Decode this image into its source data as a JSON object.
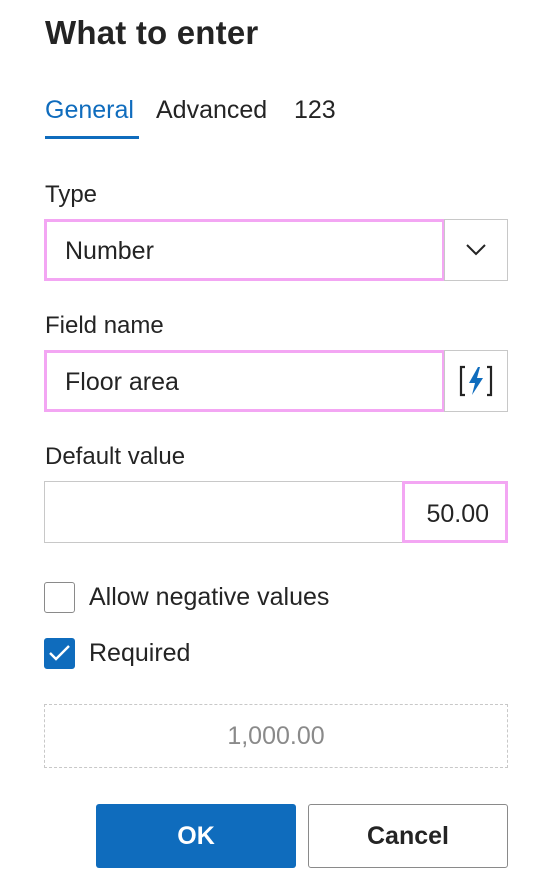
{
  "dialog": {
    "title": "What to enter"
  },
  "tabs": [
    {
      "label": "General",
      "active": true
    },
    {
      "label": "Advanced",
      "active": false
    },
    {
      "label": "123",
      "active": false
    }
  ],
  "type_field": {
    "label": "Type",
    "value": "Number",
    "icon": "chevron-down-icon"
  },
  "field_name": {
    "label": "Field name",
    "value": "Floor area",
    "icon": "dynamic-content-icon"
  },
  "default_value": {
    "label": "Default value",
    "value": "50.00"
  },
  "options": [
    {
      "label": "Allow negative values",
      "checked": false
    },
    {
      "label": "Required",
      "checked": true
    }
  ],
  "preview": {
    "value": "1,000.00"
  },
  "buttons": {
    "ok": "OK",
    "cancel": "Cancel"
  },
  "colors": {
    "accent": "#0f6cbd",
    "highlight": "#f3a6f3",
    "border": "#c8c8c8"
  }
}
